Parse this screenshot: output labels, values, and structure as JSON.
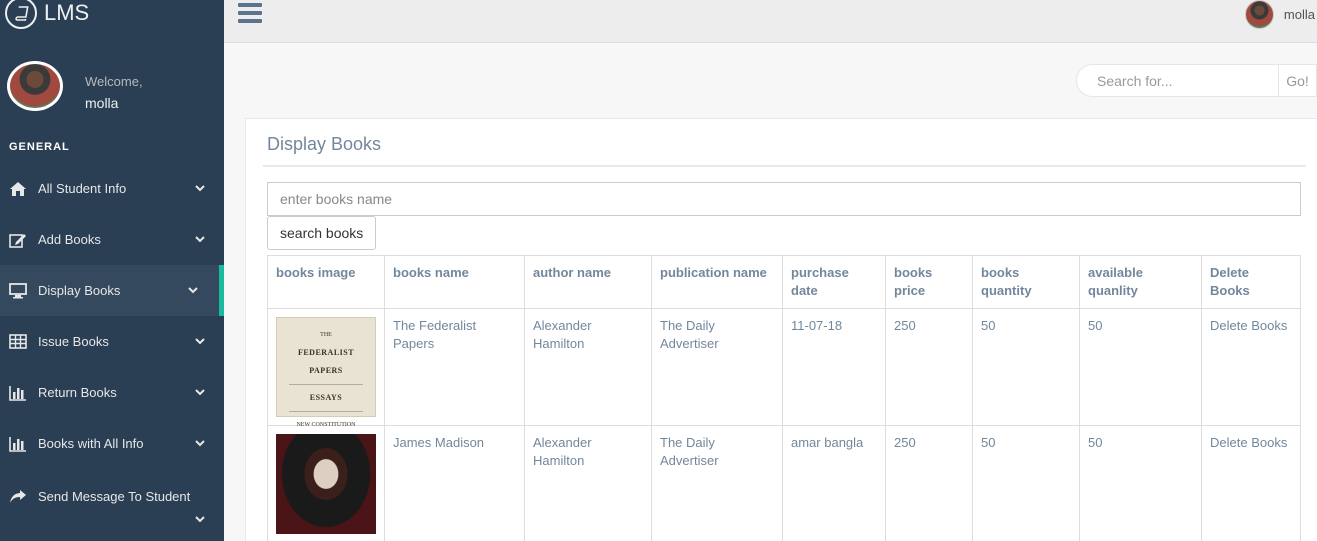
{
  "app": {
    "brand": "LMS"
  },
  "sidebar": {
    "welcome_label": "Welcome,",
    "user_name": "molla",
    "section_title": "GENERAL",
    "items": [
      {
        "label": "All Student Info",
        "icon": "home-icon"
      },
      {
        "label": "Add Books",
        "icon": "edit-icon"
      },
      {
        "label": "Display Books",
        "icon": "desktop-icon",
        "active": true
      },
      {
        "label": "Issue Books",
        "icon": "table-icon"
      },
      {
        "label": "Return Books",
        "icon": "bar-chart-icon"
      },
      {
        "label": "Books with All Info",
        "icon": "bar-chart-icon"
      },
      {
        "label": "Send Message To Student",
        "icon": "share-icon"
      }
    ]
  },
  "topbar": {
    "user_name": "molla"
  },
  "search": {
    "placeholder": "Search for...",
    "button_label": "Go!"
  },
  "panel": {
    "title": "Display Books",
    "book_search_placeholder": "enter books name",
    "search_button_label": "search books"
  },
  "table": {
    "headers": [
      "books image",
      "books name",
      "author name",
      "publication name",
      "purchase date",
      "books price",
      "books quantity",
      "available quanlity",
      "Delete Books"
    ],
    "rows": [
      {
        "image": "federalist-cover",
        "name": "The Federalist Papers",
        "author": "Alexander Hamilton",
        "publication": "The Daily Advertiser",
        "purchase_date": "11-07-18",
        "price": "250",
        "quantity": "50",
        "available": "50",
        "delete": "Delete Books"
      },
      {
        "image": "madison-portrait",
        "name": "James Madison",
        "author": "Alexander Hamilton",
        "publication": "The Daily Advertiser",
        "purchase_date": "amar bangla",
        "price": "250",
        "quantity": "50",
        "available": "50",
        "delete": "Delete Books"
      }
    ]
  },
  "cover": {
    "federalist_line1": "THE",
    "federalist_line2": "FEDERALIST PAPERS",
    "federalist_line3": "ESSAYS",
    "federalist_line4": "NEW CONSTITUTION"
  },
  "colors": {
    "sidebar_bg": "#2a3f54",
    "active_accent": "#1ABB9C",
    "text_muted": "#73879C"
  }
}
